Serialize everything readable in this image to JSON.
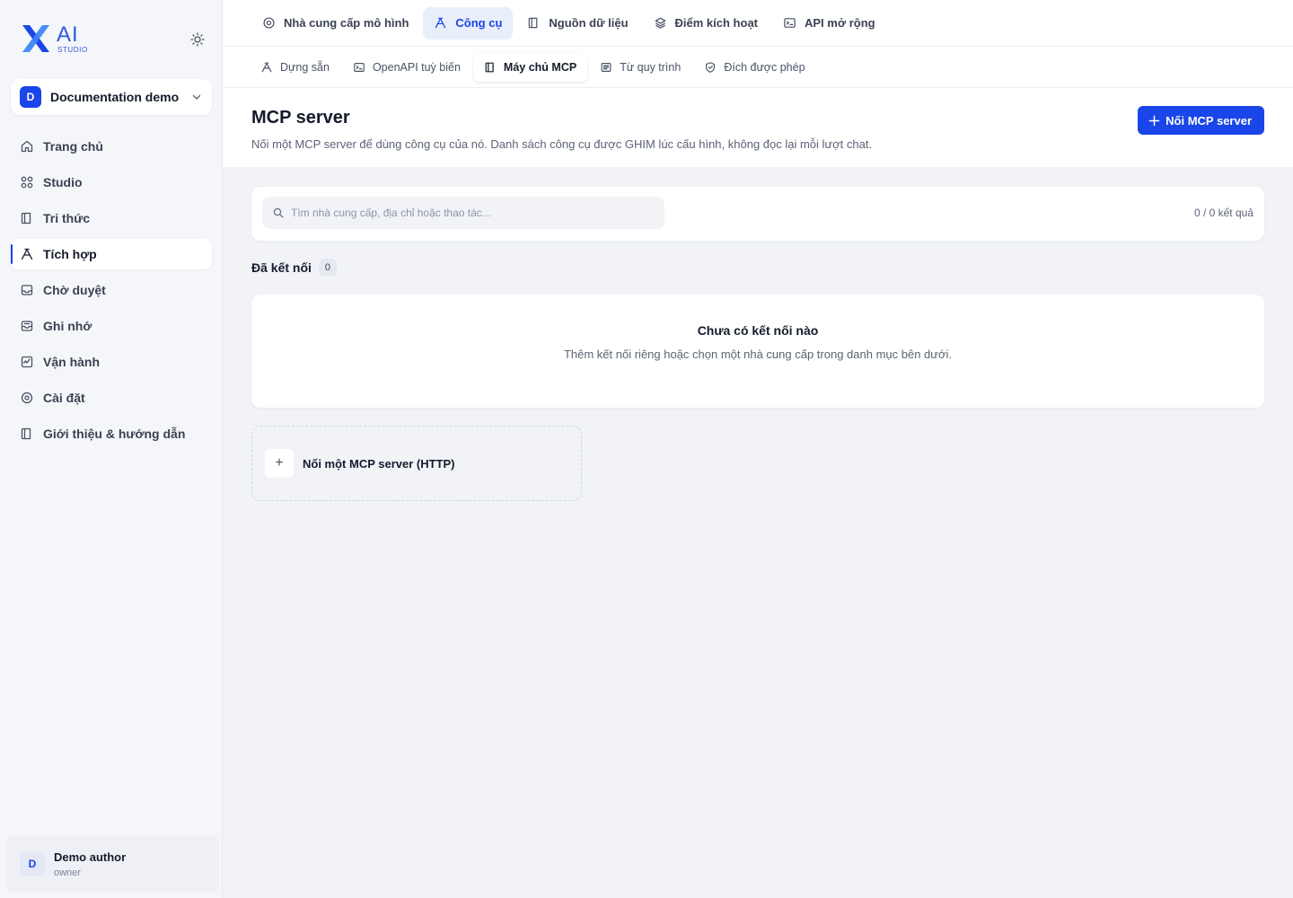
{
  "brand": {
    "logo_ai": "AI",
    "logo_studio": "STUDIO",
    "accent": "#1a45e8"
  },
  "workspace": {
    "initial": "D",
    "name": "Documentation demo"
  },
  "sidebar": {
    "items": [
      {
        "label": "Trang chủ",
        "icon": "home-icon",
        "active": false
      },
      {
        "label": "Studio",
        "icon": "grid-icon",
        "active": false
      },
      {
        "label": "Tri thức",
        "icon": "book-icon",
        "active": false
      },
      {
        "label": "Tích hợp",
        "icon": "tools-icon",
        "active": true
      },
      {
        "label": "Chờ duyệt",
        "icon": "inbox-icon",
        "active": false
      },
      {
        "label": "Ghi nhớ",
        "icon": "memory-icon",
        "active": false
      },
      {
        "label": "Vận hành",
        "icon": "activity-icon",
        "active": false
      },
      {
        "label": "Cài đặt",
        "icon": "settings-icon",
        "active": false
      },
      {
        "label": "Giới thiệu & hướng dẫn",
        "icon": "guide-icon",
        "active": false
      }
    ]
  },
  "user": {
    "initial": "D",
    "name": "Demo author",
    "role": "owner"
  },
  "top_tabs": [
    {
      "label": "Nhà cung cấp mô hình",
      "icon": "provider-icon",
      "active": false
    },
    {
      "label": "Công cụ",
      "icon": "tools-icon",
      "active": true
    },
    {
      "label": "Nguồn dữ liệu",
      "icon": "book-icon",
      "active": false
    },
    {
      "label": "Điểm kích hoạt",
      "icon": "layers-icon",
      "active": false
    },
    {
      "label": "API mở rộng",
      "icon": "terminal-icon",
      "active": false
    }
  ],
  "sub_tabs": [
    {
      "label": "Dựng sẵn",
      "icon": "tools-icon",
      "active": false
    },
    {
      "label": "OpenAPI tuỳ biến",
      "icon": "terminal-icon",
      "active": false
    },
    {
      "label": "Máy chủ MCP",
      "icon": "book-icon",
      "active": true
    },
    {
      "label": "Từ quy trình",
      "icon": "list-icon",
      "active": false
    },
    {
      "label": "Đích được phép",
      "icon": "shield-icon",
      "active": false
    }
  ],
  "page": {
    "title": "MCP server",
    "description": "Nối một MCP server để dùng công cụ của nó. Danh sách công cụ được GHIM lúc cấu hình, không đọc lại mỗi lượt chat.",
    "primary_button": "Nối MCP server"
  },
  "search": {
    "placeholder": "Tìm nhà cung cấp, địa chỉ hoặc thao tác...",
    "value": "",
    "result_count": "0 / 0 kết quả"
  },
  "connected": {
    "title": "Đã kết nối",
    "count": "0"
  },
  "empty_state": {
    "title": "Chưa có kết nối nào",
    "description": "Thêm kết nối riêng hoặc chọn một nhà cung cấp trong danh mục bên dưới."
  },
  "add_card": {
    "plus": "+",
    "label": "Nối một MCP server (HTTP)"
  }
}
